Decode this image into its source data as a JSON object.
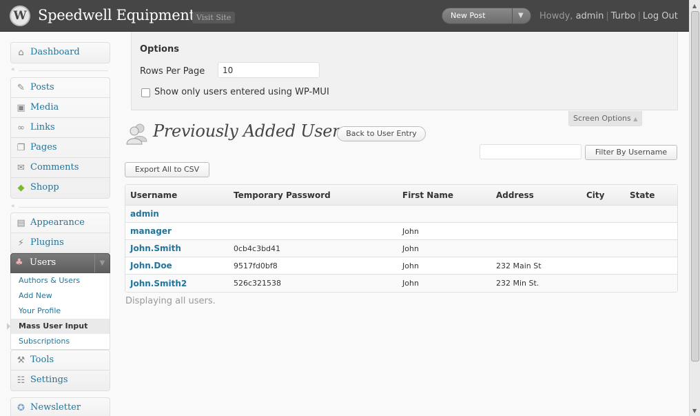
{
  "header": {
    "site_title": "Speedwell Equipment",
    "visit_site": "Visit Site",
    "new_post": "New Post",
    "howdy": "Howdy,",
    "username": "admin",
    "links": [
      "Turbo",
      "Log Out"
    ]
  },
  "menu": {
    "group1": [
      {
        "label": "Dashboard",
        "icon": "dashboard-icon"
      }
    ],
    "group2": [
      {
        "label": "Posts",
        "icon": "pushpin-icon"
      },
      {
        "label": "Media",
        "icon": "media-icon"
      },
      {
        "label": "Links",
        "icon": "link-icon"
      },
      {
        "label": "Pages",
        "icon": "pages-icon"
      },
      {
        "label": "Comments",
        "icon": "comment-icon"
      },
      {
        "label": "Shopp",
        "icon": "price-tag-icon"
      }
    ],
    "group3": [
      {
        "label": "Appearance",
        "icon": "appearance-icon"
      },
      {
        "label": "Plugins",
        "icon": "plugin-icon"
      }
    ],
    "users": {
      "label": "Users",
      "submenu": [
        "Authors & Users",
        "Add New",
        "Your Profile",
        "Mass User Input",
        "Subscriptions"
      ],
      "current": "Mass User Input"
    },
    "group4": [
      {
        "label": "Tools",
        "icon": "tools-icon"
      },
      {
        "label": "Settings",
        "icon": "settings-icon"
      }
    ],
    "group5": [
      {
        "label": "Newsletter",
        "icon": "newsletter-icon"
      }
    ]
  },
  "screen_options": {
    "title": "Options",
    "rows_label": "Rows Per Page",
    "rows_value": "10",
    "checkbox_label": "Show only users entered using WP-MUI",
    "tab_label": "Screen Options"
  },
  "page": {
    "title": "Previously Added Users",
    "back_button": "Back to User Entry",
    "export_button": "Export All to CSV",
    "filter_button": "Filter By Username",
    "filter_value": "",
    "status": "Displaying all users."
  },
  "table": {
    "columns": [
      "Username",
      "Temporary Password",
      "First Name",
      "Address",
      "City",
      "State"
    ],
    "rows": [
      [
        "admin",
        "",
        "",
        "",
        "",
        ""
      ],
      [
        "manager",
        "",
        "John",
        "",
        "",
        ""
      ],
      [
        "John.Smith",
        "0cb4c3bd41",
        "John",
        "",
        "",
        ""
      ],
      [
        "John.Doe",
        "9517fd0bf8",
        "John",
        "232 Main St",
        "",
        ""
      ],
      [
        "John.Smith2",
        "526c321538",
        "John",
        "232 Min St.",
        "",
        ""
      ]
    ]
  },
  "colors": {
    "header_bg": "#464646",
    "link": "#21759b",
    "menu_active": "#6d6d6d"
  }
}
